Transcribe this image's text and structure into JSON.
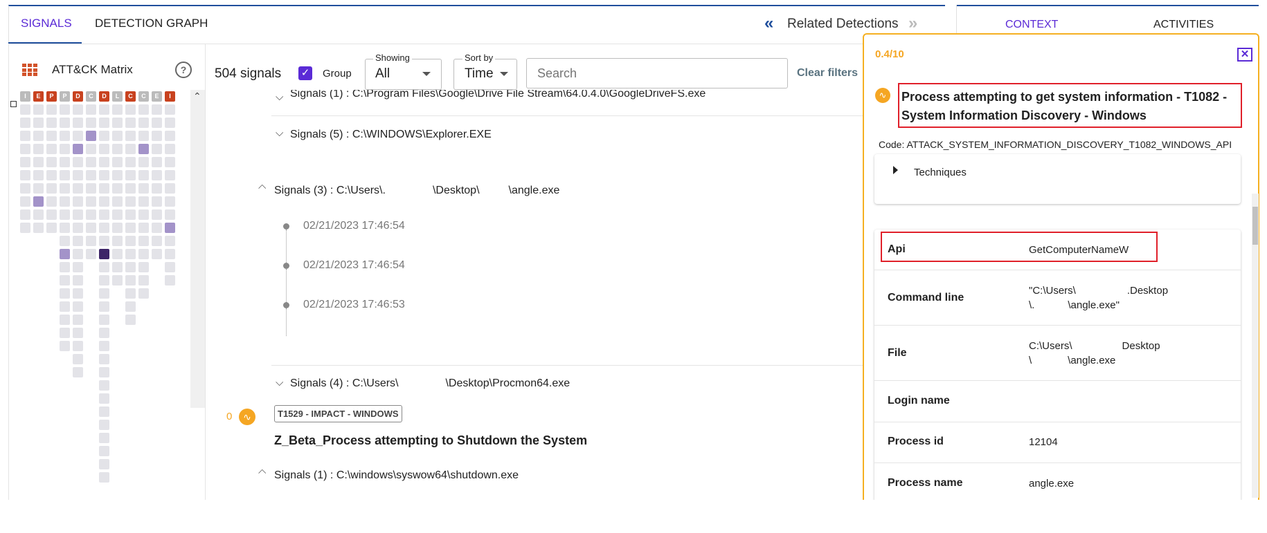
{
  "tabs": {
    "signals": "SIGNALS",
    "detection_graph": "DETECTION GRAPH",
    "related": "Related Detections",
    "related_prev": "«",
    "related_next": "»",
    "context": "CONTEXT",
    "activities": "ACTIVITIES"
  },
  "matrix": {
    "title": "ATT&CK Matrix",
    "help": "?",
    "headers": [
      {
        "l": "I",
        "c": "#bbbbbb"
      },
      {
        "l": "E",
        "c": "#c8421f"
      },
      {
        "l": "P",
        "c": "#c8421f"
      },
      {
        "l": "P",
        "c": "#bbbbbb"
      },
      {
        "l": "D",
        "c": "#c8421f"
      },
      {
        "l": "C",
        "c": "#bbbbbb"
      },
      {
        "l": "D",
        "c": "#c8421f"
      },
      {
        "l": "L",
        "c": "#bbbbbb"
      },
      {
        "l": "C",
        "c": "#c8421f"
      },
      {
        "l": "C",
        "c": "#bbbbbb"
      },
      {
        "l": "E",
        "c": "#bbbbbb"
      },
      {
        "l": "I",
        "c": "#c8421f"
      }
    ]
  },
  "toolbar": {
    "count": "504 signals",
    "group_label": "Group",
    "showing_label": "Showing",
    "showing_value": "All",
    "sort_label": "Sort by",
    "sort_value": "Time",
    "search_placeholder": "Search",
    "clear_filters": "Clear filters"
  },
  "signals": {
    "s1": "Signals (1) : C:\\Program Files\\Google\\Drive File Stream\\64.0.4.0\\GoogleDriveFS.exe",
    "s2": "Signals (5) : C:\\WINDOWS\\Explorer.EXE",
    "s3a": "Signals (3) : C:\\Users\\.",
    "s3b": "\\Desktop\\",
    "s3c": "\\angle.exe",
    "timestamps": [
      "02/21/2023 17:46:54",
      "02/21/2023 17:46:54",
      "02/21/2023 17:46:53"
    ],
    "s4a": "Signals (4) : C:\\Users\\",
    "s4b": "\\Desktop\\Procmon64.exe",
    "score": "0",
    "badge": "T1529 - IMPACT - WINDOWS",
    "detection_title": "Z_Beta_Process attempting to Shutdown the System",
    "s5": "Signals (1) : C:\\windows\\syswow64\\shutdown.exe"
  },
  "panel": {
    "score": "0.4/10",
    "title": "Process attempting to get system information - T1082 - System Information Discovery - Windows",
    "code": "Code: ATTACK_SYSTEM_INFORMATION_DISCOVERY_T1082_WINDOWS_API",
    "techniques": "Techniques",
    "rows": {
      "api_label": "Api",
      "api_value": "GetComputerNameW",
      "cmd_label": "Command line",
      "cmd_value_1": "\"C:\\Users\\",
      "cmd_value_1b": ".Desktop",
      "cmd_value_2": "\\.",
      "cmd_value_2b": "\\angle.exe\"",
      "file_label": "File",
      "file_value_1": "C:\\Users\\",
      "file_value_1b": "Desktop",
      "file_value_2": "\\",
      "file_value_2b": "\\angle.exe",
      "login_label": "Login name",
      "pid_label": "Process id",
      "pid_value": "12104",
      "pname_label": "Process name",
      "pname_value": "angle.exe"
    }
  },
  "colors": {
    "accent": "#5b2bd6",
    "orange": "#f5a623",
    "red": "#e0202a",
    "navy": "#1f4e9c"
  }
}
